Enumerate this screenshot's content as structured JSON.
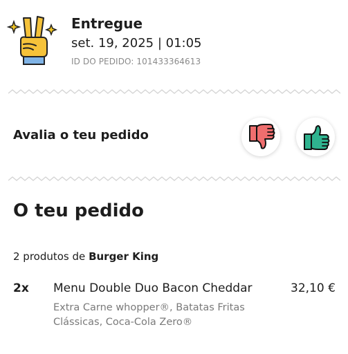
{
  "status": {
    "icon": "victory-hand-icon",
    "title": "Entregue",
    "date": "set. 19, 2025 | 01:05",
    "order_id": "ID DO PEDIDO: 101433364613"
  },
  "rating": {
    "label": "Avalia o teu pedido",
    "thumbs_down_icon": "thumbs-down-icon",
    "thumbs_up_icon": "thumbs-up-icon",
    "colors": {
      "negative": "#ef6e6e",
      "positive": "#2fb38f"
    }
  },
  "order": {
    "heading": "O teu pedido",
    "summary_prefix": "2 produtos de",
    "store": "Burger King",
    "items": [
      {
        "qty": "2x",
        "name": "Menu Double Duo Bacon Cheddar",
        "price": "32,10 €",
        "extras": "Extra Carne whopper®, Batatas Fritas Clássicas, Coca-Cola Zero®"
      }
    ]
  }
}
